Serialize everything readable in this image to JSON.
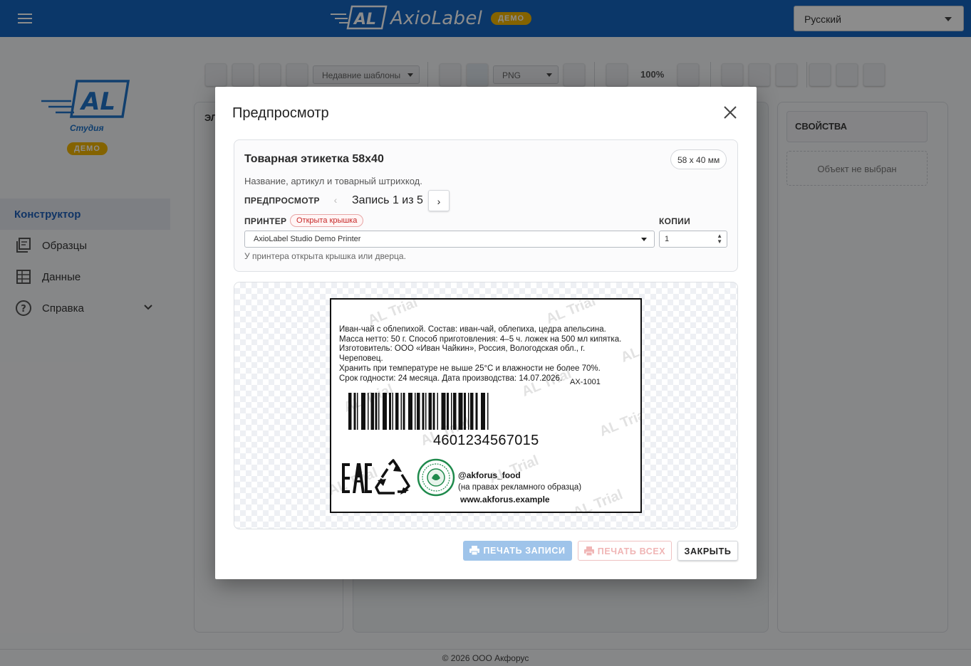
{
  "header": {
    "brand_name": "AxioLabel",
    "brand_logo_text": "AL",
    "demo_badge": "ДЕМО",
    "language": "Русский"
  },
  "sidebar": {
    "studio_label": "Студия",
    "demo_badge": "ДЕМО",
    "items": [
      {
        "label": "Конструктор",
        "icon": "constructor-icon",
        "active": true
      },
      {
        "label": "Образцы",
        "icon": "samples-icon"
      },
      {
        "label": "Данные",
        "icon": "table-icon"
      },
      {
        "label": "Справка",
        "icon": "help-icon",
        "expandable": true
      }
    ]
  },
  "toolbar": {
    "recent_templates_placeholder": "Недавние шаблоны",
    "export_format": "PNG",
    "zoom": "100%"
  },
  "elements_panel": {
    "title_partial": "ЭЛ"
  },
  "properties_panel": {
    "title": "СВОЙСТВА",
    "empty_text": "Объект не выбран"
  },
  "footer": {
    "text": "© 2026 ООО Акфорус"
  },
  "modal": {
    "title": "Предпросмотр",
    "template_name": "Товарная этикетка 58x40",
    "size": "58 x 40 мм",
    "description": "Название, артикул и товарный штрихкод.",
    "preview_label": "ПРЕДПРОСМОТР",
    "record_text": "Запись 1 из 5",
    "printer_label": "ПРИНТЕР",
    "printer_status": "Открыта крышка",
    "printer_name": "AxioLabel Studio Demo Printer",
    "copies_label": "КОПИИ",
    "copies_value": "1",
    "printer_warning": "У принтера открыта крышка или дверца.",
    "buttons": {
      "print_record": "ПЕЧАТЬ ЗАПИСИ",
      "print_all": "ПЕЧАТЬ ВСЕХ",
      "close": "ЗАКРЫТЬ"
    }
  },
  "label_preview": {
    "composition_lines": [
      "Иван-чай с облепихой. Состав: иван-чай, облепиха, цедра апельсина.",
      "Масса нетто: 50 г. Способ приготовления: 4–5 ч. ложек на 500 мл кипятка.",
      "Изготовитель: ООО «Иван Чайкин», Россия, Вологодская обл., г.",
      "Череповец.",
      "Хранить при температуре не выше 25°С и влажности не более 70%.",
      "Срок годности: 24 месяца. Дата производства: 14.07.2026."
    ],
    "article": "AX-1001",
    "ean": "4601234567015",
    "social": "@akforus_food",
    "ad_note": "(на правах рекламного образца)",
    "website": "www.akforus.example",
    "watermark": "AL Trial"
  },
  "colors": {
    "header_bg": "#1565c0",
    "accent": "#1e5fb8",
    "demo_badge": "#f0b400",
    "status_error": "#c62828"
  }
}
